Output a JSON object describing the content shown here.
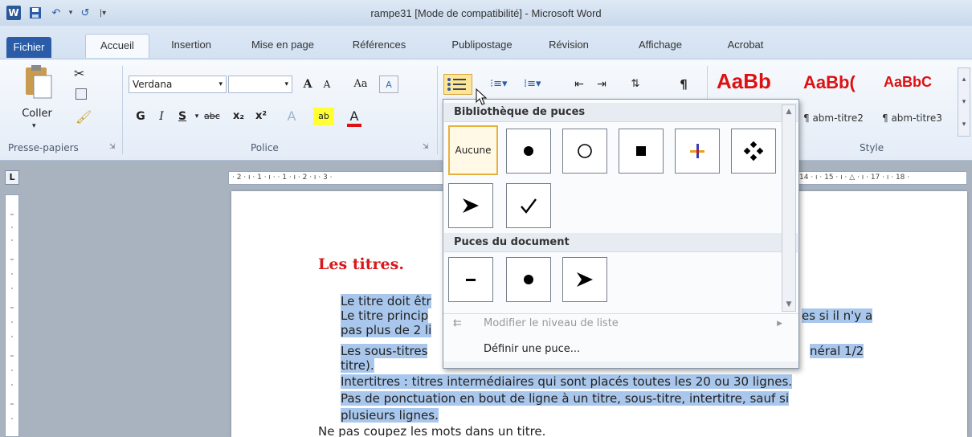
{
  "window": {
    "title": "rampe31 [Mode de compatibilité] - Microsoft Word",
    "word_logo": "W"
  },
  "tabs": {
    "file": "Fichier",
    "home": "Accueil",
    "insert": "Insertion",
    "layout": "Mise en page",
    "references": "Références",
    "mailings": "Publipostage",
    "review": "Révision",
    "view": "Affichage",
    "acrobat": "Acrobat"
  },
  "clipboard": {
    "paste_label": "Coller",
    "group_label": "Presse-papiers"
  },
  "font": {
    "font_name": "Verdana",
    "font_size": "",
    "group_label": "Police",
    "bold": "G",
    "italic": "I",
    "underline": "S",
    "strike": "abc",
    "subscript": "x₂",
    "superscript": "x²",
    "grow": "A",
    "shrink": "A",
    "case": "Aa"
  },
  "styles": {
    "group_label": "Style",
    "samples": [
      "AaBb",
      "AaBb(",
      "AaBbC"
    ],
    "names": [
      "¶ abm-titre2",
      "¶ abm-titre3"
    ]
  },
  "ruler": {
    "text": "· 2 · ı · 1 · ı ·   · 1 · ı · 2 · ı · 3 ·",
    "text_right": "14 · ı · 15 · ı · △ · ı · 17 · ı · 18 ·"
  },
  "document": {
    "heading": "Les titres.",
    "lines": [
      "Le titre doit êtr",
      "Le titre princip",
      "pas plus de 2 li",
      "Les sous-titres",
      "titre).",
      "Intertitres : titres intermédiaires qui sont placés toutes les 20 ou 30 lignes.",
      "Pas de ponctuation en bout de ligne à un titre, sous-titre, intertitre, sauf si",
      "plusieurs lignes.",
      "Ne pas coupez les mots dans un titre."
    ],
    "right_fragments": {
      "line2": "es si il n'y a",
      "line4": "néral 1/2"
    }
  },
  "bullet_menu": {
    "library_header": "Bibliothèque de puces",
    "document_header": "Puces du document",
    "none_label": "Aucune",
    "library_bullets": [
      "filled-circle",
      "hollow-circle",
      "square",
      "crosshair",
      "diamond-cluster",
      "arrowhead",
      "checkmark"
    ],
    "document_bullets": [
      "dash",
      "filled-circle",
      "arrowhead"
    ],
    "change_level": "Modifier le niveau de liste",
    "define_new": "Définir une puce..."
  },
  "colors": {
    "accent": "#2a5ca8",
    "heading": "#d7191c",
    "selection": "#a9c7ec",
    "hover": "#e8b13c"
  }
}
